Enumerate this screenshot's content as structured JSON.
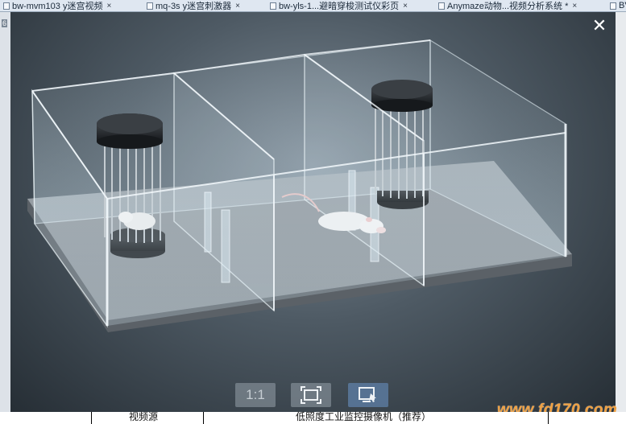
{
  "tabs": [
    {
      "label": "bw-mvm103 y迷宫视频",
      "close": "×"
    },
    {
      "label": "mq-3s y迷宫刺激器",
      "close": "×"
    },
    {
      "label": "bw-yls-1...避暗穿梭测试仪彩页",
      "close": "×"
    },
    {
      "label": "Anymaze动物...视频分析系统 *",
      "close": "×"
    },
    {
      "label": "BV",
      "close": ""
    }
  ],
  "side_number": "6",
  "viewer": {
    "close_symbol": "✕",
    "toolbar": {
      "actual_size_label": "1:1",
      "fit_icon": "fit-screen-icon",
      "capture_icon": "screen-capture-icon"
    }
  },
  "watermark": "www.fd170.com",
  "table_row": {
    "cell1": "视频源",
    "cell2": "低照度工业监控摄像机（推荐）"
  }
}
